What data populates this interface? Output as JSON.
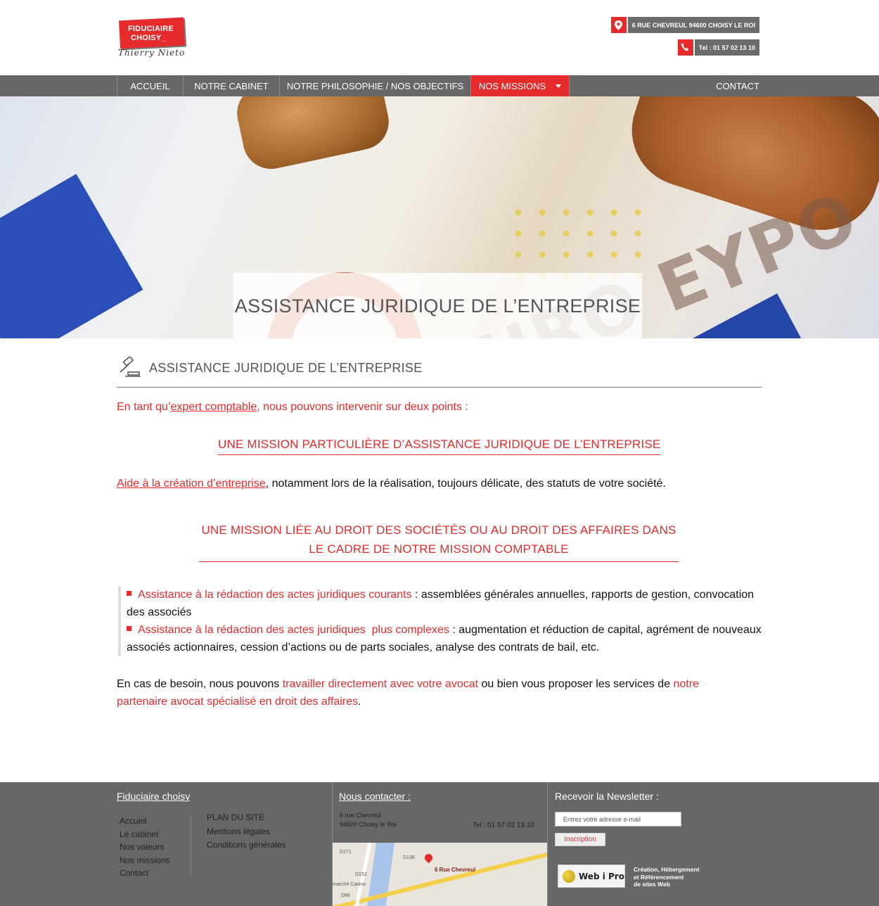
{
  "brand": {
    "logo_line1": "FIDUCIAIRE",
    "logo_line2": "CHOISY_",
    "logo_signature": "Thierry Nieto",
    "accent_color": "#e52b2b",
    "dark_color": "#666767"
  },
  "header": {
    "address": "6 RUE CHEVREUL 94600 CHOISY LE ROI",
    "address_icon": "map-pin-icon",
    "phone": "Tel : 01 57 02 13 10",
    "phone_icon": "phone-icon"
  },
  "nav": {
    "items": [
      {
        "label": "ACCUEIL"
      },
      {
        "label": "NOTRE CABINET"
      },
      {
        "label": "NOTRE PHILOSOPHIE / NOS OBJECTIFS"
      },
      {
        "label": "NOS MISSIONS",
        "active": true
      },
      {
        "label": "CONTACT"
      }
    ]
  },
  "hero": {
    "title": "ASSISTANCE JURIDIQUE DE L’ENTREPRISE",
    "image_text": "EURO EYPO"
  },
  "content": {
    "section_title": "ASSISTANCE JURIDIQUE DE L’ENTREPRISE",
    "intro_before": "En tant qu’",
    "intro_link": "expert comptable",
    "intro_after": ", nous pouvons intervenir sur deux points :",
    "mission1_heading": "UNE MISSION PARTICULIÈRE D’ASSISTANCE JURIDIQUE DE L’ENTREPRISE",
    "aide_link": "Aide à la création d’entreprise",
    "aide_after": ", notamment lors de la réalisation, toujours délicate, des statuts de votre société.",
    "mission2_line1": "UNE MISSION LIÉE AU DROIT DES SOCIÉTÉS OU AU DROIT DES AFFAIRES DANS",
    "mission2_line2": "LE CADRE DE NOTRE MISSION COMPTABLE",
    "list": [
      {
        "highlight": "Assistance à la rédaction des actes juridiques courants",
        "rest": " : assemblées générales annuelles, rapports de gestion, convocation des associés"
      },
      {
        "highlight": "Assistance à la rédaction des actes juridiques  plus complexes",
        "rest": " : augmentation et réduction de capital, agrément de nouveaux associés actionnaires, cession d’actions ou de parts sociales, analyse des contrats de bail, etc."
      }
    ],
    "outro_1": "En cas de besoin, nous pouvons ",
    "outro_red1": "travailler directement avec votre avocat",
    "outro_2": " ou bien vous proposer les services de ",
    "outro_red2": "notre partenaire avocat spécialisé en droit des affaires",
    "outro_3": "."
  },
  "footer": {
    "col1_title": "Fiduciaire choisy",
    "links": [
      "Accueil",
      "Le cabinet",
      "Nos valeurs",
      "Nos missions",
      "Contact"
    ],
    "links2": [
      "PLAN DU SITE",
      "Mentions légales",
      "Conditions générales"
    ],
    "col2_title": "Nous contacter :",
    "address_line1": "6 rue Chevreul",
    "address_line2": "94600 Choisy le Roi",
    "tel": "Tel : 01 57 02 13 10",
    "map_label": "6 Rue Chevreul",
    "map_roads": [
      "D271",
      "D138",
      "D152",
      "D86",
      "marché Casino"
    ],
    "col3_title": "Recevoir la Newsletter :",
    "newsletter_placeholder": "Entrez votre adresse e-mail",
    "newsletter_button": "Inscription",
    "partner_logo": "Web i Pro",
    "partner_desc": [
      "Création, Hébergement",
      "et Référencement",
      "de sites Web"
    ]
  }
}
